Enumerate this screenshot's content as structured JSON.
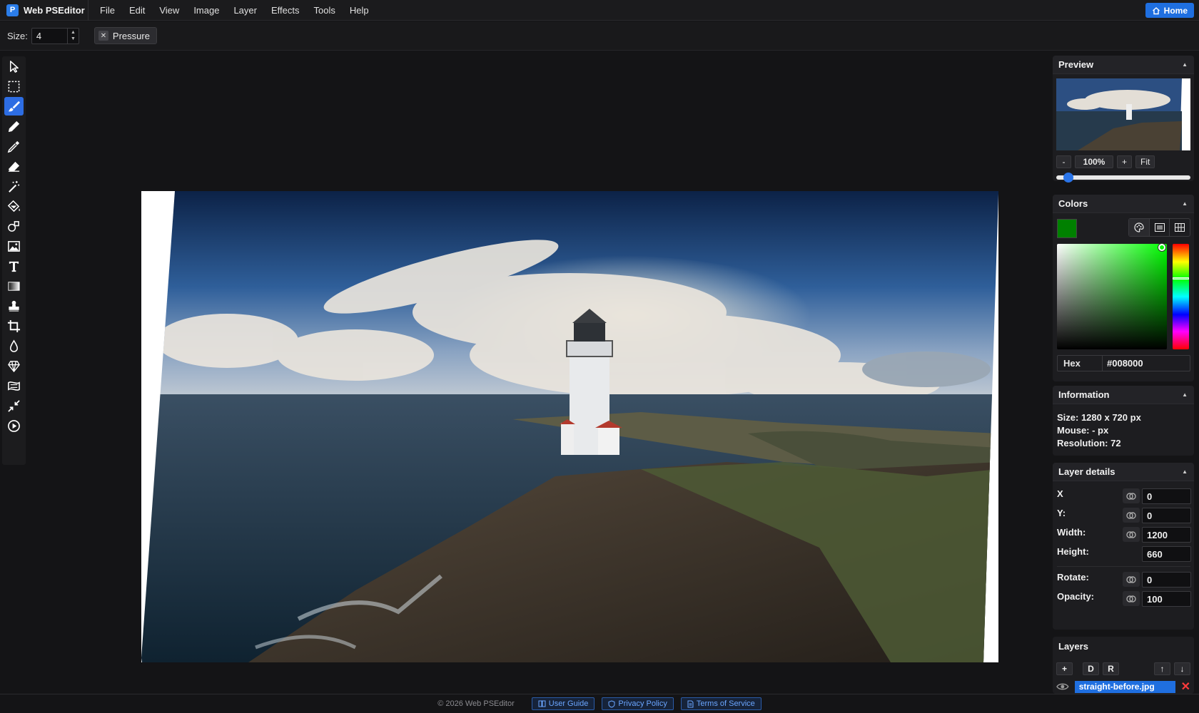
{
  "app": {
    "brand_logo": "P",
    "brand_name": "Web PSEditor",
    "home_label": "Home"
  },
  "menu": [
    "File",
    "Edit",
    "View",
    "Image",
    "Layer",
    "Effects",
    "Tools",
    "Help"
  ],
  "options": {
    "size_label": "Size:",
    "size_value": "4",
    "pressure_label": "Pressure"
  },
  "tools": [
    {
      "name": "select-tool",
      "icon": "cursor-icon"
    },
    {
      "name": "marquee-tool",
      "icon": "marquee-icon"
    },
    {
      "name": "brush-tool",
      "icon": "brush-icon",
      "active": true
    },
    {
      "name": "pencil-tool",
      "icon": "pencil-icon"
    },
    {
      "name": "color-picker-tool",
      "icon": "eyedropper-icon"
    },
    {
      "name": "eraser-tool",
      "icon": "eraser-icon"
    },
    {
      "name": "magic-wand-tool",
      "icon": "magic-wand-icon"
    },
    {
      "name": "fill-tool",
      "icon": "paint-bucket-icon"
    },
    {
      "name": "shape-tool",
      "icon": "shapes-icon"
    },
    {
      "name": "image-tool",
      "icon": "image-icon"
    },
    {
      "name": "text-tool",
      "icon": "text-icon"
    },
    {
      "name": "gradient-tool",
      "icon": "gradient-icon"
    },
    {
      "name": "clone-tool",
      "icon": "stamp-icon"
    },
    {
      "name": "crop-tool",
      "icon": "crop-icon"
    },
    {
      "name": "blur-tool",
      "icon": "drop-icon"
    },
    {
      "name": "sharpen-tool",
      "icon": "diamond-icon"
    },
    {
      "name": "bulge-tool",
      "icon": "warp-icon"
    },
    {
      "name": "resize-tool",
      "icon": "shrink-icon"
    },
    {
      "name": "animation-tool",
      "icon": "play-icon"
    }
  ],
  "preview": {
    "title": "Preview",
    "zoom_minus": "-",
    "zoom_value": "100%",
    "zoom_plus": "+",
    "fit_label": "Fit",
    "zoom_level": 0.06
  },
  "colors": {
    "title": "Colors",
    "current": "#008000",
    "hex_label": "Hex",
    "hex_value": "#008000"
  },
  "information": {
    "title": "Information",
    "size": "Size: 1280 x 720 px",
    "mouse": "Mouse: - px",
    "resolution": "Resolution: 72"
  },
  "layer_details": {
    "title": "Layer details",
    "x_label": "X",
    "x_value": "0",
    "y_label": "Y:",
    "y_value": "0",
    "width_label": "Width:",
    "width_value": "1200",
    "height_label": "Height:",
    "height_value": "660",
    "rotate_label": "Rotate:",
    "rotate_value": "0",
    "opacity_label": "Opacity:",
    "opacity_value": "100"
  },
  "layers": {
    "title": "Layers",
    "add": "+",
    "duplicate": "D",
    "raster": "R",
    "up": "↑",
    "down": "↓",
    "items": [
      {
        "name": "straight-before.jpg",
        "delete": "✕"
      }
    ]
  },
  "footer": {
    "copyright": "© 2026 Web PSEditor",
    "user_guide": "User Guide",
    "privacy": "Privacy Policy",
    "terms": "Terms of Service"
  }
}
